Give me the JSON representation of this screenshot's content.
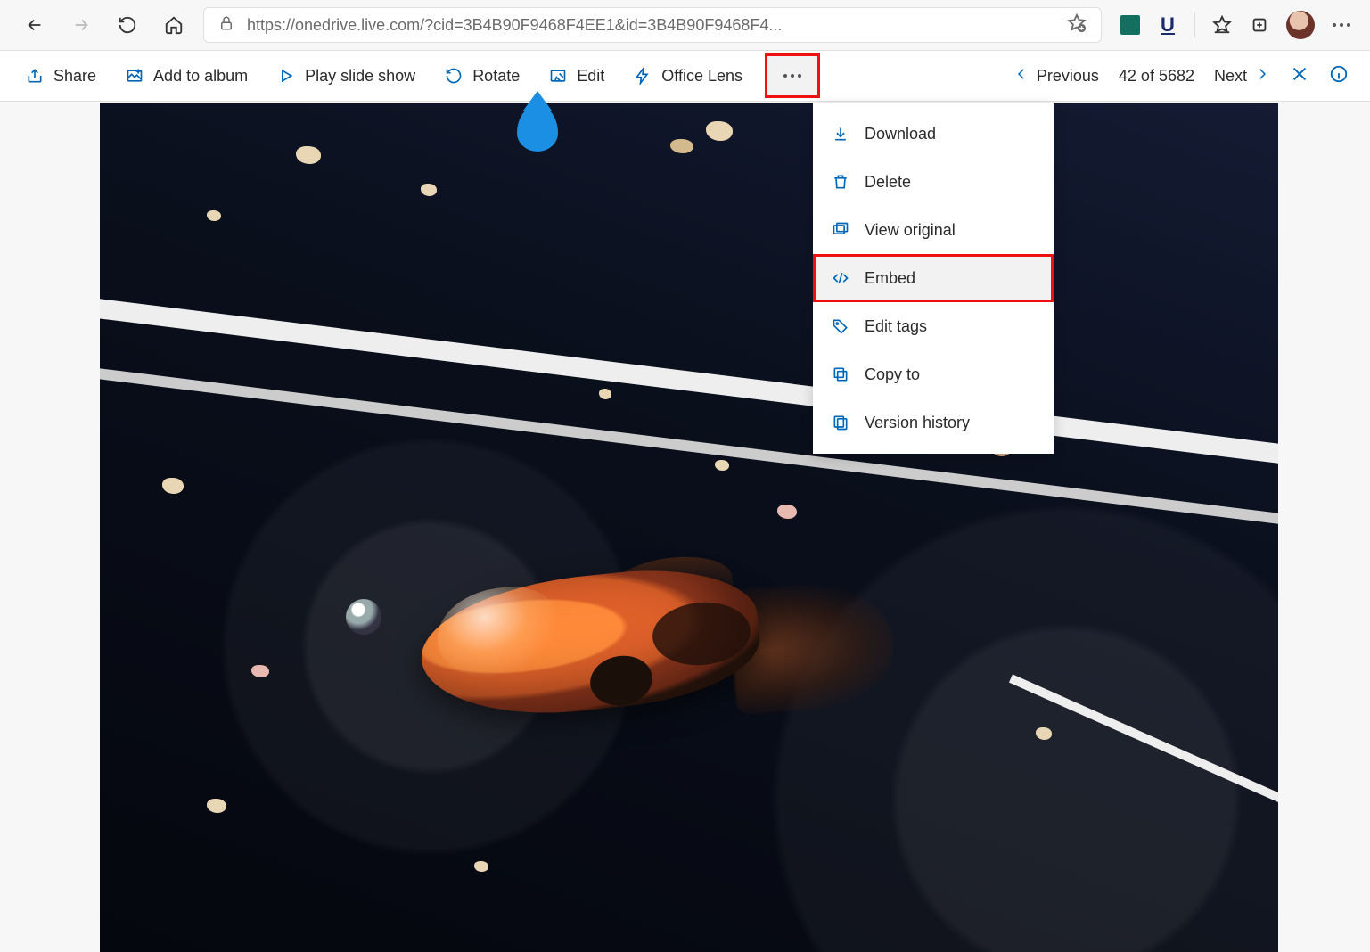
{
  "browser": {
    "url_display": "https://onedrive.live.com/?cid=3B4B90F9468F4EE1&id=3B4B90F9468F4..."
  },
  "toolbar": {
    "share": "Share",
    "add_to_album": "Add to album",
    "play_slide_show": "Play slide show",
    "rotate": "Rotate",
    "edit": "Edit",
    "office_lens": "Office Lens"
  },
  "nav": {
    "previous": "Previous",
    "counter": "42 of 5682",
    "next": "Next"
  },
  "menu": {
    "download": "Download",
    "delete": "Delete",
    "view_original": "View original",
    "embed": "Embed",
    "edit_tags": "Edit tags",
    "copy_to": "Copy to",
    "version_history": "Version history"
  }
}
